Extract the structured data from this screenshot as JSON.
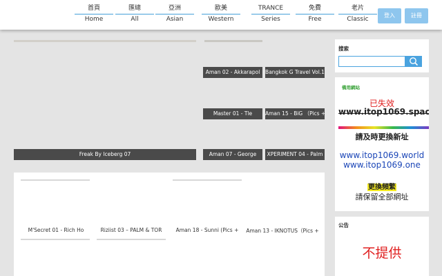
{
  "nav": {
    "items": [
      {
        "zh": "首頁",
        "en": "Home"
      },
      {
        "zh": "匯總",
        "en": "All"
      },
      {
        "zh": "亞洲",
        "en": "Asian"
      },
      {
        "zh": "歐美",
        "en": "Western"
      },
      {
        "zh": "TRANCE",
        "en": "Series"
      },
      {
        "zh": "免費",
        "en": "Free"
      },
      {
        "zh": "老片",
        "en": "Classic"
      }
    ],
    "login_label": "登入",
    "register_label": "註冊"
  },
  "main": {
    "featured_caption": "Freak By Iceberg 07",
    "grid_captions": [
      "Aman 02 - Akkarapol",
      "Bangkok G Travel Vol.1",
      "Master 01 - Tle",
      "Aman 15 - BiG （Pics +",
      "Aman 07 - George",
      "XPERIMENT 04 - Palm"
    ],
    "bottom_captions": [
      "M'Secret 01 - Rich Ho",
      "Riziist 03 – PALM & TOR",
      "Aman 18 - Sunni (Pics +",
      "Aman 13 - IKNOTUS（Pics +"
    ]
  },
  "sidebar": {
    "search_title": "搜索",
    "search_value": "",
    "links_title": "備用網站",
    "expired_text": "已失效",
    "old_url": "www.itop1069.space",
    "please_change": "請及時更換新址",
    "new_urls": [
      "www.itop1069.world",
      "www.itop1069.one"
    ],
    "change_often": "更換頻繁",
    "keep_all": "請保留全部網址",
    "notice_title": "公告",
    "notice_text": "不提供"
  },
  "colors": {
    "accent": "#8ec6ee",
    "nav_underline": "#44a0d8",
    "caption_bg": "#4a4a4a",
    "alert_red": "#e02020",
    "link_blue": "#1b46b7",
    "highlight_yellow": "#f6ec21"
  }
}
